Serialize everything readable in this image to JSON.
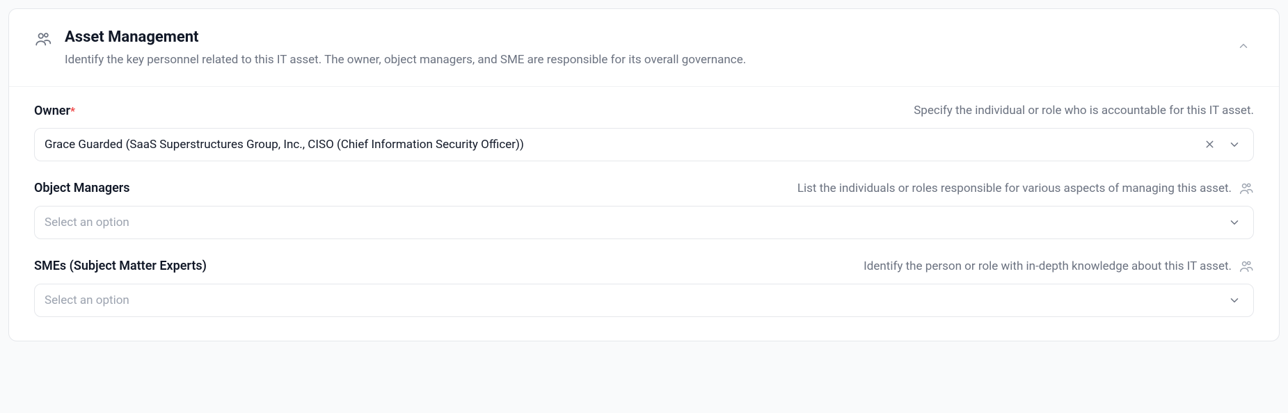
{
  "panel": {
    "title": "Asset Management",
    "subtitle": "Identify the key personnel related to this IT asset. The owner, object managers, and SME are responsible for its overall governance."
  },
  "fields": {
    "owner": {
      "label": "Owner",
      "required_mark": "*",
      "hint": "Specify the individual or role who is accountable for this IT asset.",
      "value": "Grace Guarded (SaaS Superstructures Group, Inc., CISO (Chief Information Security Officer))"
    },
    "managers": {
      "label": "Object Managers",
      "hint": "List the individuals or roles responsible for various aspects of managing this asset.",
      "placeholder": "Select an option"
    },
    "smes": {
      "label": "SMEs (Subject Matter Experts)",
      "hint": "Identify the person or role with in-depth knowledge about this IT asset.",
      "placeholder": "Select an option"
    }
  }
}
